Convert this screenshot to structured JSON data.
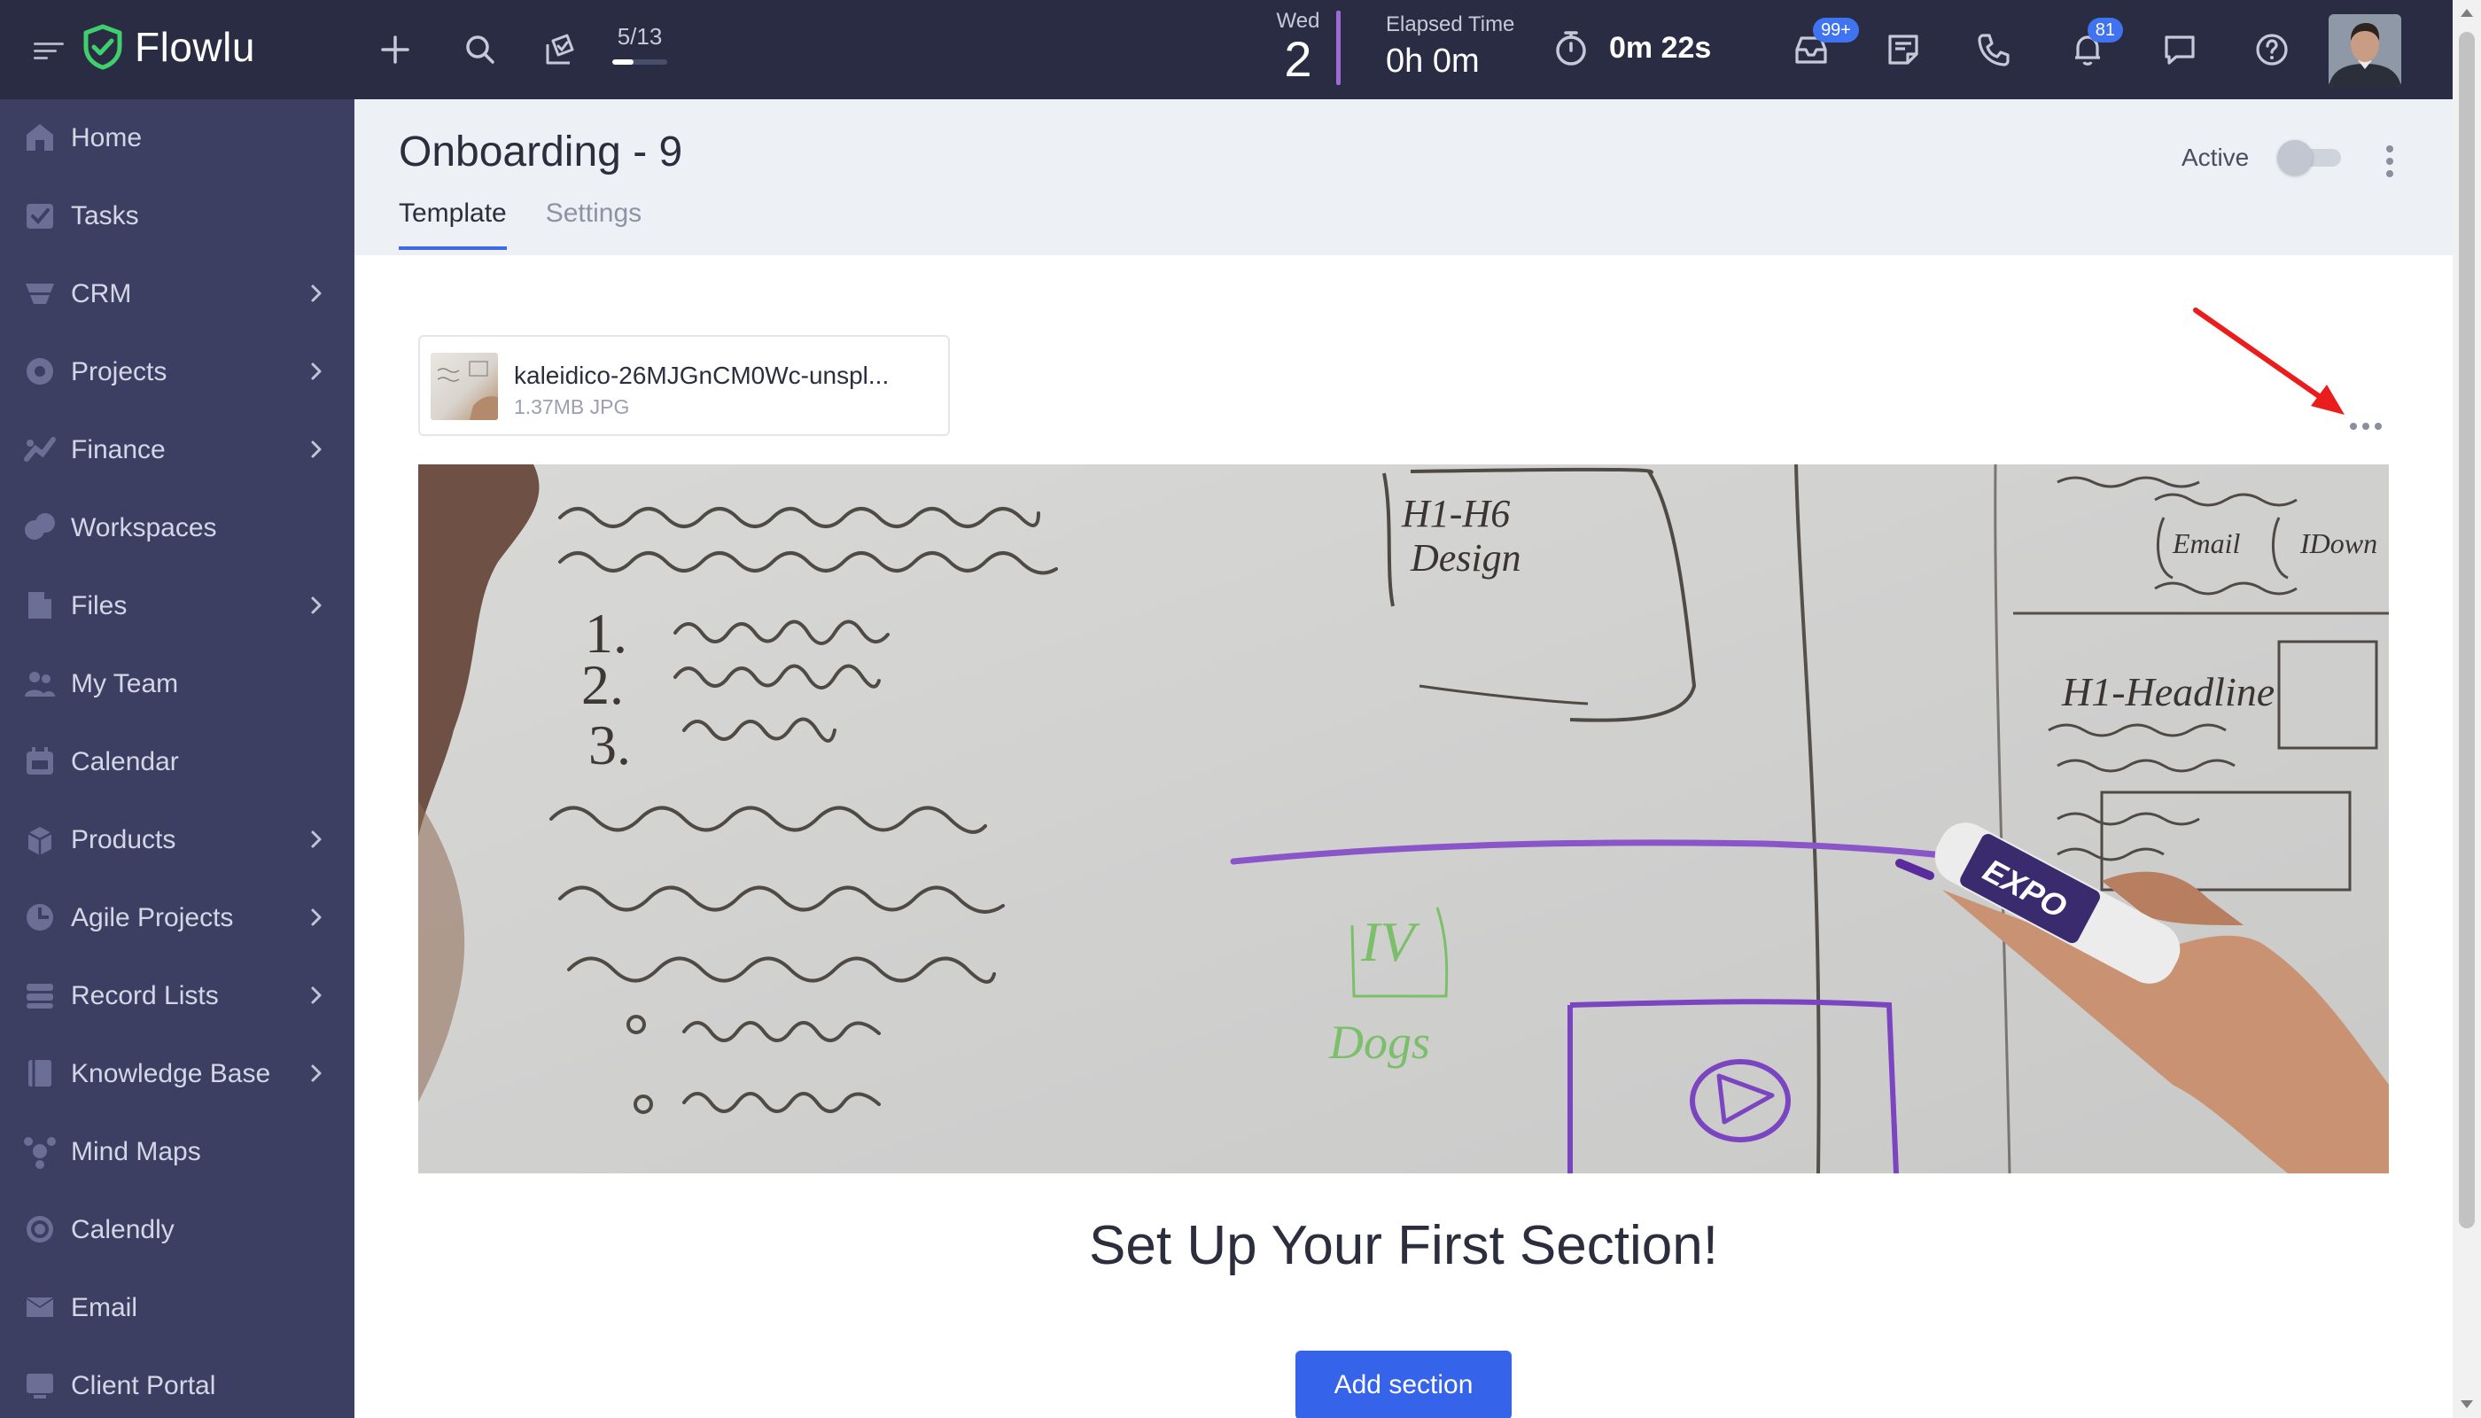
{
  "topbar": {
    "app_name": "Flowlu",
    "task_counter": {
      "text": "5/13",
      "progress": 0.38
    },
    "date": {
      "day_of_week": "Wed",
      "day": "2"
    },
    "elapsed": {
      "label": "Elapsed Time",
      "value": "0h 0m"
    },
    "timer": {
      "value": "0m 22s"
    },
    "mail_badge": "99+",
    "notifications_badge": "81",
    "brand_color": "#2a2c44",
    "logo_color": "#3fcf6b"
  },
  "sidebar": {
    "items": [
      {
        "label": "Home",
        "icon": "home-icon",
        "has_submenu": false
      },
      {
        "label": "Tasks",
        "icon": "tasks-icon",
        "has_submenu": false
      },
      {
        "label": "CRM",
        "icon": "crm-icon",
        "has_submenu": true
      },
      {
        "label": "Projects",
        "icon": "projects-icon",
        "has_submenu": true
      },
      {
        "label": "Finance",
        "icon": "finance-icon",
        "has_submenu": true
      },
      {
        "label": "Workspaces",
        "icon": "workspaces-icon",
        "has_submenu": false
      },
      {
        "label": "Files",
        "icon": "files-icon",
        "has_submenu": true
      },
      {
        "label": "My Team",
        "icon": "team-icon",
        "has_submenu": false
      },
      {
        "label": "Calendar",
        "icon": "calendar-icon",
        "has_submenu": false
      },
      {
        "label": "Products",
        "icon": "products-icon",
        "has_submenu": true
      },
      {
        "label": "Agile Projects",
        "icon": "agile-icon",
        "has_submenu": true
      },
      {
        "label": "Record Lists",
        "icon": "record-lists-icon",
        "has_submenu": true
      },
      {
        "label": "Knowledge Base",
        "icon": "knowledge-base-icon",
        "has_submenu": true
      },
      {
        "label": "Mind Maps",
        "icon": "mind-maps-icon",
        "has_submenu": false
      },
      {
        "label": "Calendly",
        "icon": "calendly-icon",
        "has_submenu": false
      },
      {
        "label": "Email",
        "icon": "email-icon",
        "has_submenu": false
      },
      {
        "label": "Client Portal",
        "icon": "client-portal-icon",
        "has_submenu": false
      }
    ]
  },
  "header": {
    "title": "Onboarding - 9",
    "tabs": [
      {
        "label": "Template",
        "active": true
      },
      {
        "label": "Settings",
        "active": false
      }
    ],
    "active_label": "Active",
    "active_on": false
  },
  "content": {
    "file": {
      "name": "kaleidico-26MJGnCM0Wc-unspl...",
      "meta": "1.37MB JPG"
    },
    "whiteboard": {
      "list_numbers": [
        "1.",
        "2.",
        "3."
      ],
      "texts": [
        "H1-H6",
        "Design",
        "H1-Headline",
        "Email",
        "IDown",
        "IV",
        "Dogs",
        "EXPO"
      ]
    },
    "section_heading": "Set Up Your First Section!",
    "add_section_label": "Add section",
    "accent_color": "#3563e9"
  }
}
